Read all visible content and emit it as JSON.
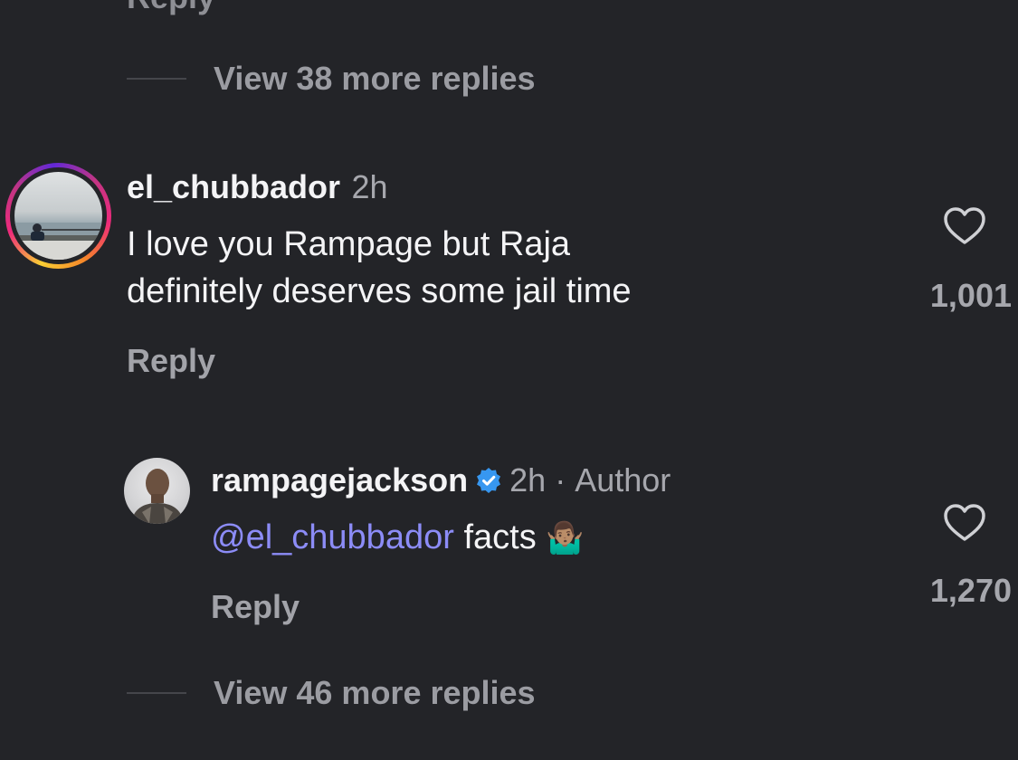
{
  "top_reply_cut": "Reply",
  "view_more_top": "View 38 more replies",
  "comment1": {
    "username": "el_chubbador",
    "time": "2h",
    "text_line1": "I love you Rampage but Raja",
    "text_line2": "definitely deserves some jail time",
    "reply_label": "Reply",
    "like_count": "1,001"
  },
  "comment2": {
    "username": "rampagejackson",
    "time": "2h",
    "separator": "·",
    "author_tag": "Author",
    "mention": "@el_chubbador",
    "text": "facts",
    "emoji": "🤷🏽‍♂️",
    "reply_label": "Reply",
    "like_count": "1,270"
  },
  "view_more_bottom": "View 46 more replies",
  "colors": {
    "background": "#232428",
    "mention": "#8c8cf7",
    "verified": "#3797f0",
    "muted": "#a6a7ad"
  },
  "icons": {
    "like": "heart-outline-icon",
    "verified": "verified-badge-icon"
  }
}
